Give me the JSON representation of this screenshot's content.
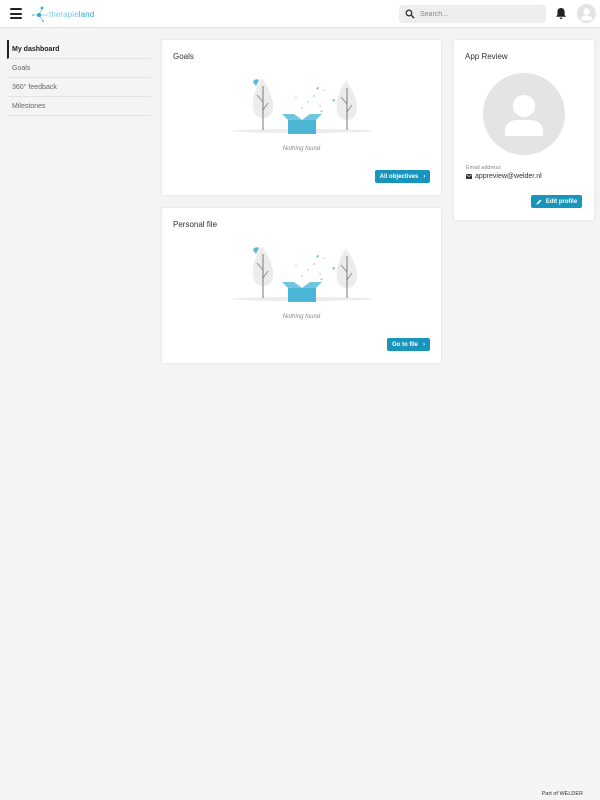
{
  "header": {
    "logo_text_light": "therapie",
    "logo_text_dark": "land",
    "search_placeholder": "Search..."
  },
  "sidebar": {
    "items": [
      {
        "label": "My dashboard",
        "active": true
      },
      {
        "label": "Goals",
        "active": false
      },
      {
        "label": "360° feedback",
        "active": false
      },
      {
        "label": "Milestones",
        "active": false
      }
    ]
  },
  "goals_card": {
    "title": "Goals",
    "empty_text": "Nothing found",
    "button_label": "All objectives"
  },
  "personal_file_card": {
    "title": "Personal file",
    "empty_text": "Nothing found",
    "button_label": "Go to file"
  },
  "profile_card": {
    "name": "App Review",
    "email_label": "Email address",
    "email": "appreview@welder.nl",
    "button_label": "Edit profile"
  },
  "footer": {
    "text": "Part of WELDER"
  },
  "colors": {
    "accent": "#1795bd",
    "logo": "#29a9d4",
    "background": "#f4f4f4"
  }
}
